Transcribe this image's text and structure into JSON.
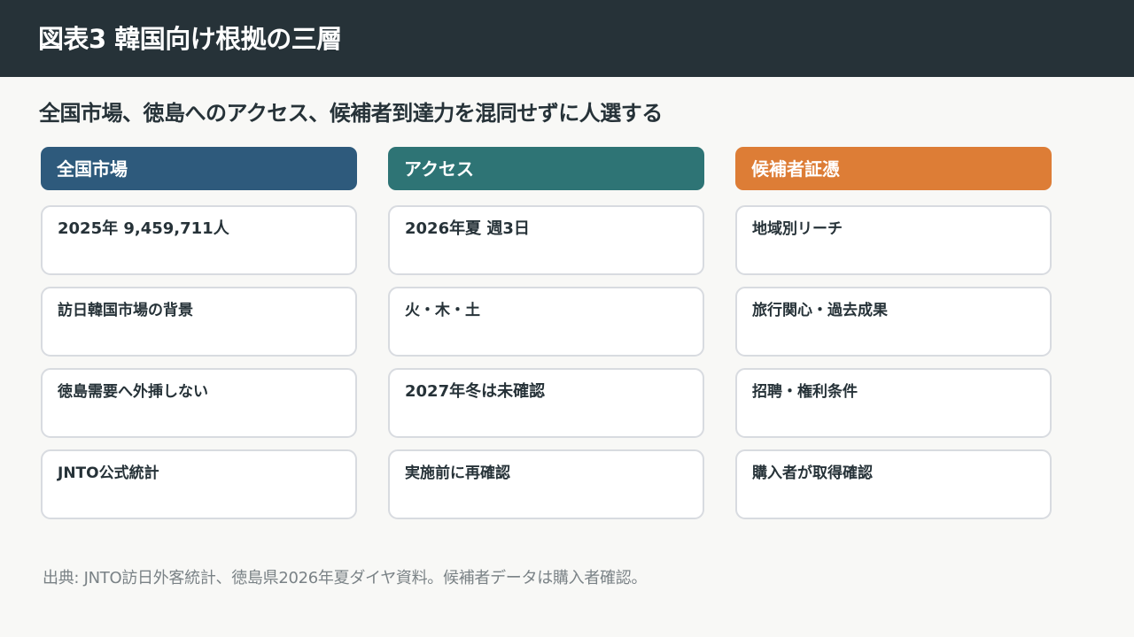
{
  "header": {
    "title": "図表3 韓国向け根拠の三層"
  },
  "subtitle": "全国市場、徳島へのアクセス、候補者到達力を混同せずに人選する",
  "columns": [
    {
      "title": "全国市場",
      "cards": [
        "2025年 9,459,711人",
        "訪日韓国市場の背景",
        "徳島需要へ外挿しない",
        "JNTO公式統計"
      ]
    },
    {
      "title": "アクセス",
      "cards": [
        "2026年夏 週3日",
        "火・木・土",
        "2027年冬は未確認",
        "実施前に再確認"
      ]
    },
    {
      "title": "候補者証憑",
      "cards": [
        "地域別リーチ",
        "旅行関心・過去成果",
        "招聘・権利条件",
        "購入者が取得確認"
      ]
    }
  ],
  "footer": "出典: JNTO訪日外客統計、徳島県2026年夏ダイヤ資料。候補者データは購入者確認。",
  "colors": {
    "header_bg": "#263238",
    "market": "#2e5a7c",
    "access": "#2e7475",
    "evidence": "#dd7d36"
  }
}
